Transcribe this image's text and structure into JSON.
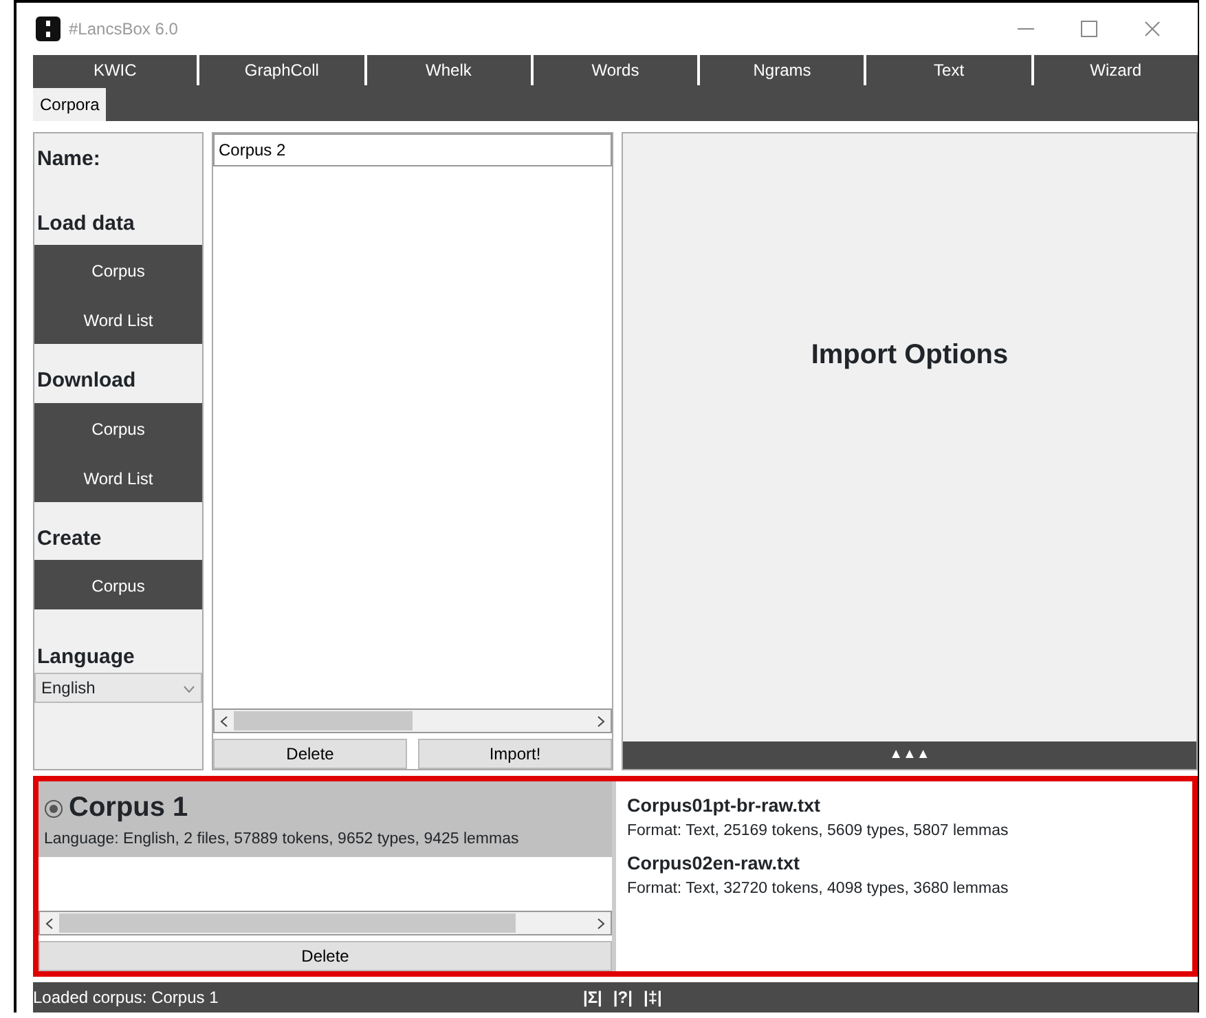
{
  "window": {
    "title": "#LancsBox 6.0"
  },
  "tabs": [
    {
      "label": "KWIC",
      "selected": false
    },
    {
      "label": "GraphColl",
      "selected": false
    },
    {
      "label": "Whelk",
      "selected": false
    },
    {
      "label": "Words",
      "selected": false
    },
    {
      "label": "Ngrams",
      "selected": false
    },
    {
      "label": "Text",
      "selected": false
    },
    {
      "label": "Wizard",
      "selected": false
    }
  ],
  "subtabs": [
    {
      "label": "Corpora",
      "selected": true
    }
  ],
  "sidebar": {
    "name_label": "Name:",
    "sections": [
      {
        "title": "Load data",
        "buttons": [
          "Corpus",
          "Word List"
        ]
      },
      {
        "title": "Download",
        "buttons": [
          "Corpus",
          "Word List"
        ]
      },
      {
        "title": "Create",
        "buttons": [
          "Corpus"
        ]
      }
    ],
    "language_label": "Language",
    "language": "English"
  },
  "name_field": {
    "value": "Corpus 2"
  },
  "file_buttons": [
    "Delete",
    "Import!"
  ],
  "import_panel": {
    "title": "Import Options",
    "toggle": "▲▲▲"
  },
  "corpora": [
    {
      "name": "Corpus 1",
      "details": "Language: English, 2 files, 57889 tokens, 9652 types, 9425 lemmas",
      "selected": true
    }
  ],
  "corpora_button": "Delete",
  "files": [
    {
      "name": "Corpus01pt-br-raw.txt",
      "details": "Format: Text, 25169 tokens, 5609 types, 5807 lemmas"
    },
    {
      "name": "Corpus02en-raw.txt",
      "details": "Format: Text, 32720 tokens, 4098 types, 3680 lemmas"
    }
  ],
  "status_bar": {
    "text": "Loaded corpus: Corpus 1",
    "tools": [
      "|Σ|",
      "|?|",
      "|‡|"
    ]
  }
}
